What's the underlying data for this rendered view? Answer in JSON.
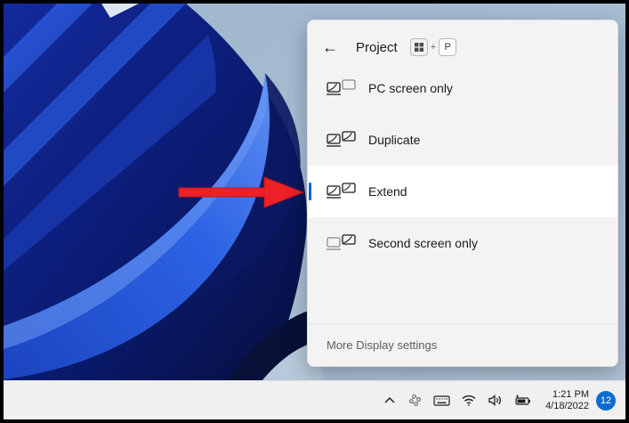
{
  "panel": {
    "title": "Project",
    "shortcut": {
      "win_key_icon": "windows-logo-key",
      "separator": "+",
      "key_label": "P"
    },
    "options": [
      {
        "label": "PC screen only",
        "selected": false,
        "icon": "pc-screen-only-icon"
      },
      {
        "label": "Duplicate",
        "selected": false,
        "icon": "duplicate-icon"
      },
      {
        "label": "Extend",
        "selected": true,
        "icon": "extend-icon"
      },
      {
        "label": "Second screen only",
        "selected": false,
        "icon": "second-screen-only-icon"
      }
    ],
    "footer_link": "More Display settings",
    "accent_color": "#0067c0",
    "selected_bg": "#ffffff",
    "panel_bg": "#f3f3f3"
  },
  "taskbar": {
    "tray_icons": [
      "chevron-up-icon",
      "slack-flower-icon",
      "touch-keyboard-icon",
      "wifi-icon",
      "volume-icon",
      "battery-charging-icon"
    ],
    "clock_time": "1:21 PM",
    "clock_date": "4/18/2022",
    "notification_count": "12",
    "badge_color": "#0b6cce"
  },
  "annotation": {
    "type": "red-arrow",
    "points_at": "Extend",
    "color": "#ec2027"
  }
}
